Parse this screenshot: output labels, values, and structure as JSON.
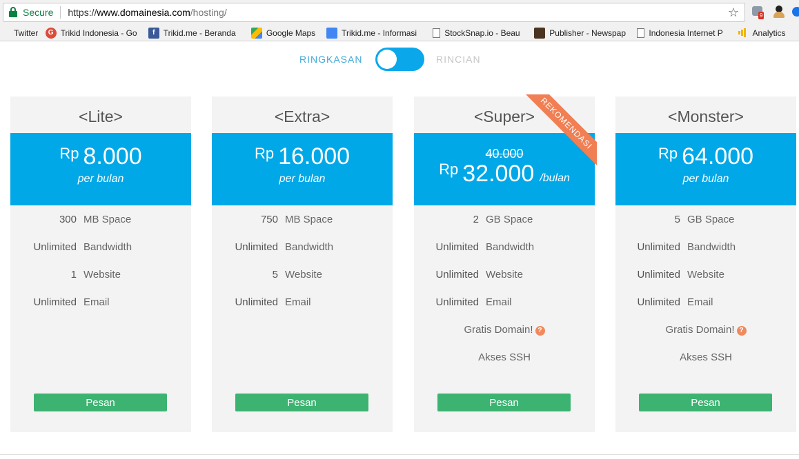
{
  "browser": {
    "secure_label": "Secure",
    "url_scheme": "https://",
    "url_host": "www.domainesia.com",
    "url_path": "/hosting/",
    "star_glyph": "☆",
    "ext_badge": "9"
  },
  "bookmarks": [
    {
      "label": "Twitter",
      "icon": "twitter-icon"
    },
    {
      "label": "Trikid Indonesia - Go",
      "icon": "google-plus-icon"
    },
    {
      "label": "Trikid.me - Beranda",
      "icon": "facebook-icon"
    },
    {
      "label": "Google Maps",
      "icon": "google-maps-icon"
    },
    {
      "label": "Trikid.me - Informasi",
      "icon": "google-my-business-icon"
    },
    {
      "label": "StockSnap.io - Beaut",
      "icon": "page-icon"
    },
    {
      "label": "Publisher - Newspap",
      "icon": "publisher-icon"
    },
    {
      "label": "Indonesia Internet P",
      "icon": "page-icon"
    },
    {
      "label": "Analytics",
      "icon": "analytics-icon"
    }
  ],
  "toggle": {
    "left_label": "RINGKASAN",
    "right_label": "RINCIAN"
  },
  "plans": [
    {
      "title": "<Lite>",
      "currency": "Rp",
      "price": "8.000",
      "period": "per bulan",
      "features": [
        {
          "value": "300",
          "label": "MB Space"
        },
        {
          "value": "Unlimited",
          "label": "Bandwidth"
        },
        {
          "value": "1",
          "label": "Website"
        },
        {
          "value": "Unlimited",
          "label": "Email"
        }
      ],
      "button": "Pesan"
    },
    {
      "title": "<Extra>",
      "currency": "Rp",
      "price": "16.000",
      "period": "per bulan",
      "features": [
        {
          "value": "750",
          "label": "MB Space"
        },
        {
          "value": "Unlimited",
          "label": "Bandwidth"
        },
        {
          "value": "5",
          "label": "Website"
        },
        {
          "value": "Unlimited",
          "label": "Email"
        }
      ],
      "button": "Pesan"
    },
    {
      "title": "<Super>",
      "ribbon": "REKOMENDASI",
      "old_price": "40.000",
      "currency": "Rp",
      "price": "32.000",
      "period": "/bulan",
      "features": [
        {
          "value": "2",
          "label": "GB Space"
        },
        {
          "value": "Unlimited",
          "label": "Bandwidth"
        },
        {
          "value": "Unlimited",
          "label": "Website"
        },
        {
          "value": "Unlimited",
          "label": "Email"
        }
      ],
      "extras": [
        "Gratis Domain!",
        "Akses SSH"
      ],
      "help_glyph": "?",
      "button": "Pesan"
    },
    {
      "title": "<Monster>",
      "currency": "Rp",
      "price": "64.000",
      "period": "per bulan",
      "features": [
        {
          "value": "5",
          "label": "GB Space"
        },
        {
          "value": "Unlimited",
          "label": "Bandwidth"
        },
        {
          "value": "Unlimited",
          "label": "Website"
        },
        {
          "value": "Unlimited",
          "label": "Email"
        }
      ],
      "extras": [
        "Gratis Domain!",
        "Akses SSH"
      ],
      "help_glyph": "?",
      "button": "Pesan"
    }
  ],
  "colors": {
    "price_box": "#00a8e8",
    "order_button": "#3cb371",
    "ribbon": "#f07f54",
    "toggle": "#0aa8ea"
  }
}
